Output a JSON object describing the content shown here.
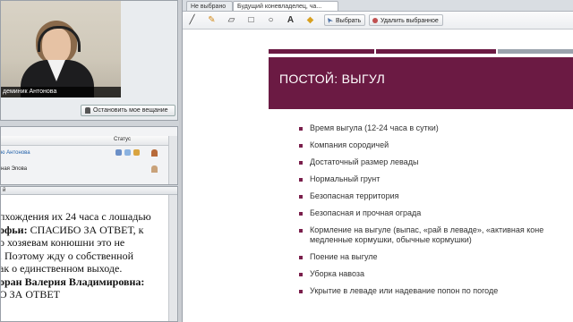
{
  "video": {
    "name_label": "деминик Антонова",
    "stop_button": "Остановить мое вещание"
  },
  "users": {
    "status_header": "Статус",
    "rows": [
      {
        "name": "ю Антонова"
      },
      {
        "name": "ная Элова"
      }
    ]
  },
  "chat": {
    "tab_label": "й",
    "lines": [
      {
        "prefix": "",
        "bold": "",
        "text": "пхождения их 24 часа с лошадью"
      },
      {
        "prefix": "",
        "bold": "офьи:",
        "text": " СПАСИБО ЗА ОТВЕТ, к"
      },
      {
        "prefix": "",
        "bold": "",
        "text": "о хозяевам конюшни это не"
      },
      {
        "prefix": "",
        "bold": "",
        "text": ". Поэтому жду о собственной"
      },
      {
        "prefix": "",
        "bold": "",
        "text": "ак о единственном выходе."
      },
      {
        "prefix": "",
        "bold": "оран Валерия Владимировна:",
        "text": ""
      },
      {
        "prefix": "",
        "bold": "",
        "text": "О ЗА ОТВЕТ"
      }
    ]
  },
  "tabs": [
    {
      "label": "Не выбрано"
    },
    {
      "label": "Будущий коневладелец, ча..."
    }
  ],
  "toolbar": {
    "select_label": "Выбрать",
    "delete_label": "Удалить выбранное"
  },
  "slide": {
    "title": "ПОСТОЙ: ВЫГУЛ",
    "bullets": [
      "Время выгула (12-24 часа в сутки)",
      "Компания сородичей",
      "Достаточный размер левады",
      "Нормальный грунт",
      "Безопасная территория",
      "Безопасная и прочная ограда",
      "Кормление на выгуле (выпас, «рай в леваде», «активная коне",
      "медленные кормушки, обычные кормушки)",
      "Поение на выгуле",
      "Уборка навоза",
      "Укрытие в леваде или надевание попон по погоде"
    ]
  },
  "colors": {
    "slide_accent": "#6b1a43",
    "bar_gray": "#9aa3ad"
  }
}
